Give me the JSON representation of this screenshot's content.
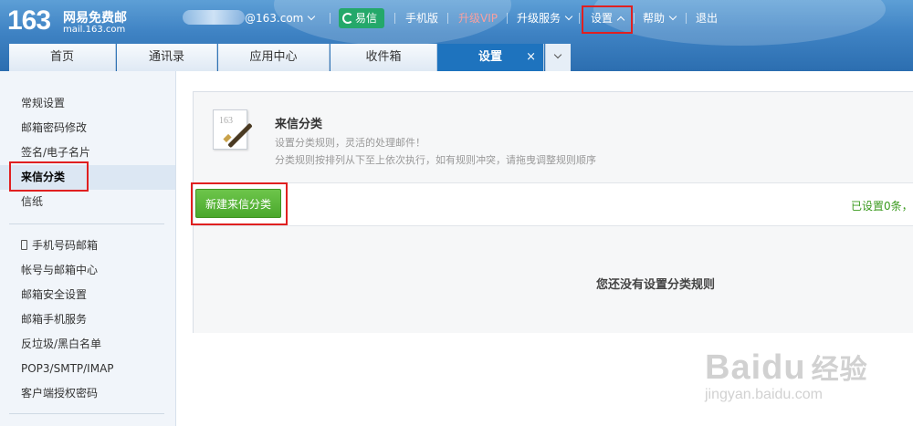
{
  "header": {
    "logo_number": "163",
    "logo_title": "网易免费邮",
    "logo_domain": "mail.163.com",
    "user_email_suffix": "@163.com",
    "nav": {
      "yixin": "易信",
      "mobile": "手机版",
      "upgrade_vip": "升级VIP",
      "upgrade_service": "升级服务",
      "settings": "设置",
      "help": "帮助",
      "logout": "退出"
    }
  },
  "tabs": [
    {
      "label": "首页"
    },
    {
      "label": "通讯录"
    },
    {
      "label": "应用中心"
    },
    {
      "label": "收件箱"
    },
    {
      "label": "设置",
      "active": true
    }
  ],
  "tab_close_glyph": "×",
  "sidebar": {
    "group1": [
      "常规设置",
      "邮箱密码修改",
      "签名/电子名片",
      "来信分类",
      "信纸"
    ],
    "active_item": "来信分类",
    "group2": [
      "手机号码邮箱",
      "帐号与邮箱中心",
      "邮箱安全设置",
      "邮箱手机服务",
      "反垃圾/黑白名单",
      "POP3/SMTP/IMAP",
      "客户端授权密码"
    ]
  },
  "panel": {
    "icon_number": "163",
    "title": "来信分类",
    "desc1": "设置分类规则，灵活的处理邮件！",
    "desc2": "分类规则按排列从下至上依次执行，如有规则冲突，请拖曳调整规则顺序",
    "new_button": "新建来信分类",
    "count_text": "已设置0条，",
    "empty_text": "您还没有设置分类规则"
  },
  "watermark": {
    "brand": "Bai",
    "brand2": "du",
    "brand_cn": "经验",
    "url": "jingyan.baidu.com"
  },
  "colors": {
    "header_blue": "#3f83c4",
    "active_tab": "#1e73be",
    "upgrade_vip_red": "#f7a0a0",
    "green_button": "#4aa82c",
    "highlight_red": "#e02020"
  }
}
